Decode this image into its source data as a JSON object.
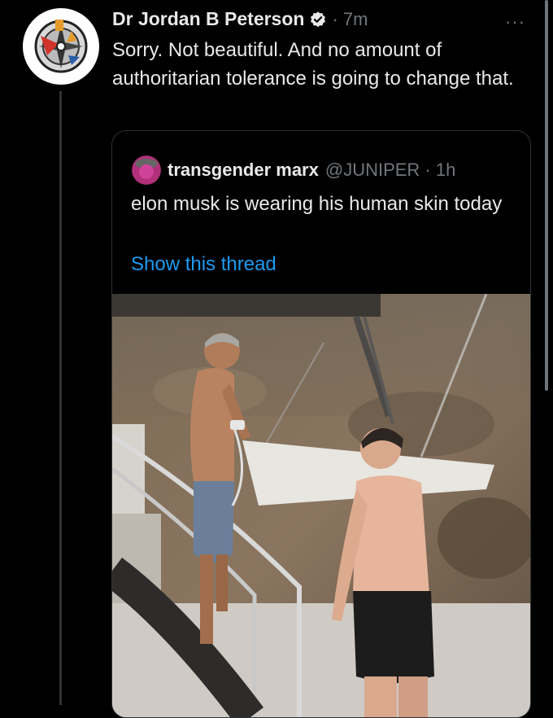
{
  "tweet": {
    "author_name": "Dr Jordan B Peterson",
    "time": "· 7m",
    "more_label": "···",
    "text": "Sorry. Not beautiful. And no amount of authoritarian tolerance is going to change that."
  },
  "quoted_tweet": {
    "author_name": "transgender marx",
    "handle_time": "@JUNIPER · 1h",
    "text": "elon musk is wearing his human skin today",
    "thread_link": "Show this thread"
  },
  "colors": {
    "background": "#000000",
    "text": "#e7e9ea",
    "muted": "#71767b",
    "link": "#1d9bf0",
    "border": "#2f3336"
  },
  "icons": [
    "verified-badge-icon",
    "more-options-icon"
  ]
}
